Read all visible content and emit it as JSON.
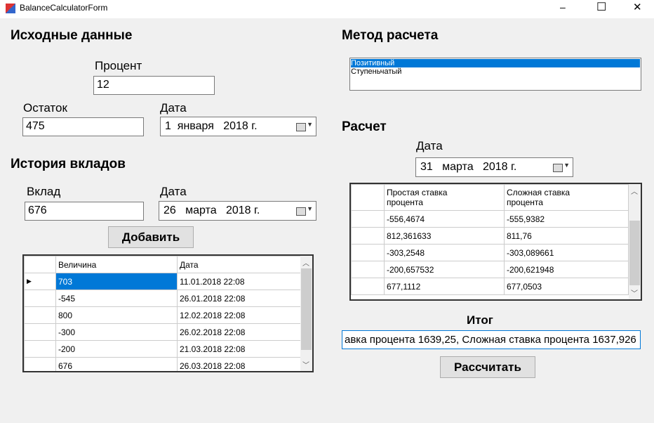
{
  "window": {
    "title": "BalanceCalculatorForm",
    "minimize": "–",
    "maximize": "☐",
    "close": "✕"
  },
  "input": {
    "heading": "Исходные данные",
    "percent_label": "Процент",
    "percent": "12",
    "balance_label": "Остаток",
    "balance": "475",
    "date_label": "Дата",
    "date": "1  января   2018 г."
  },
  "history": {
    "heading": "История вкладов",
    "deposit_label": "Вклад",
    "deposit": "676",
    "date_label": "Дата",
    "date": "26   марта   2018 г.",
    "add_button": "Добавить",
    "columns": [
      "Величина",
      "Дата"
    ],
    "rows": [
      [
        "703",
        "11.01.2018 22:08"
      ],
      [
        "-545",
        "26.01.2018 22:08"
      ],
      [
        "800",
        "12.02.2018 22:08"
      ],
      [
        "-300",
        "26.02.2018 22:08"
      ],
      [
        "-200",
        "21.03.2018 22:08"
      ],
      [
        "676",
        "26.03.2018 22:08"
      ]
    ]
  },
  "method": {
    "heading": "Метод расчета",
    "options": [
      "Позитивный",
      "Ступеньчатый"
    ],
    "selected": "Позитивный"
  },
  "calc": {
    "heading": "Расчет",
    "date_label": "Дата",
    "date": "31   марта   2018 г.",
    "columns": [
      "Простая ставка\nпроцента",
      "Сложная ставка\nпроцента"
    ],
    "rows": [
      [
        "-556,4674",
        "-555,9382"
      ],
      [
        "812,361633",
        "811,76"
      ],
      [
        "-303,2548",
        "-303,089661"
      ],
      [
        "-200,657532",
        "-200,621948"
      ],
      [
        "677,1112",
        "677,0503"
      ]
    ],
    "result_label": "Итог",
    "result": "авка процента 1639,25, Сложная ставка процента 1637,926",
    "calc_button": "Рассчитать"
  },
  "colors": {
    "selection": "#0078d7"
  }
}
